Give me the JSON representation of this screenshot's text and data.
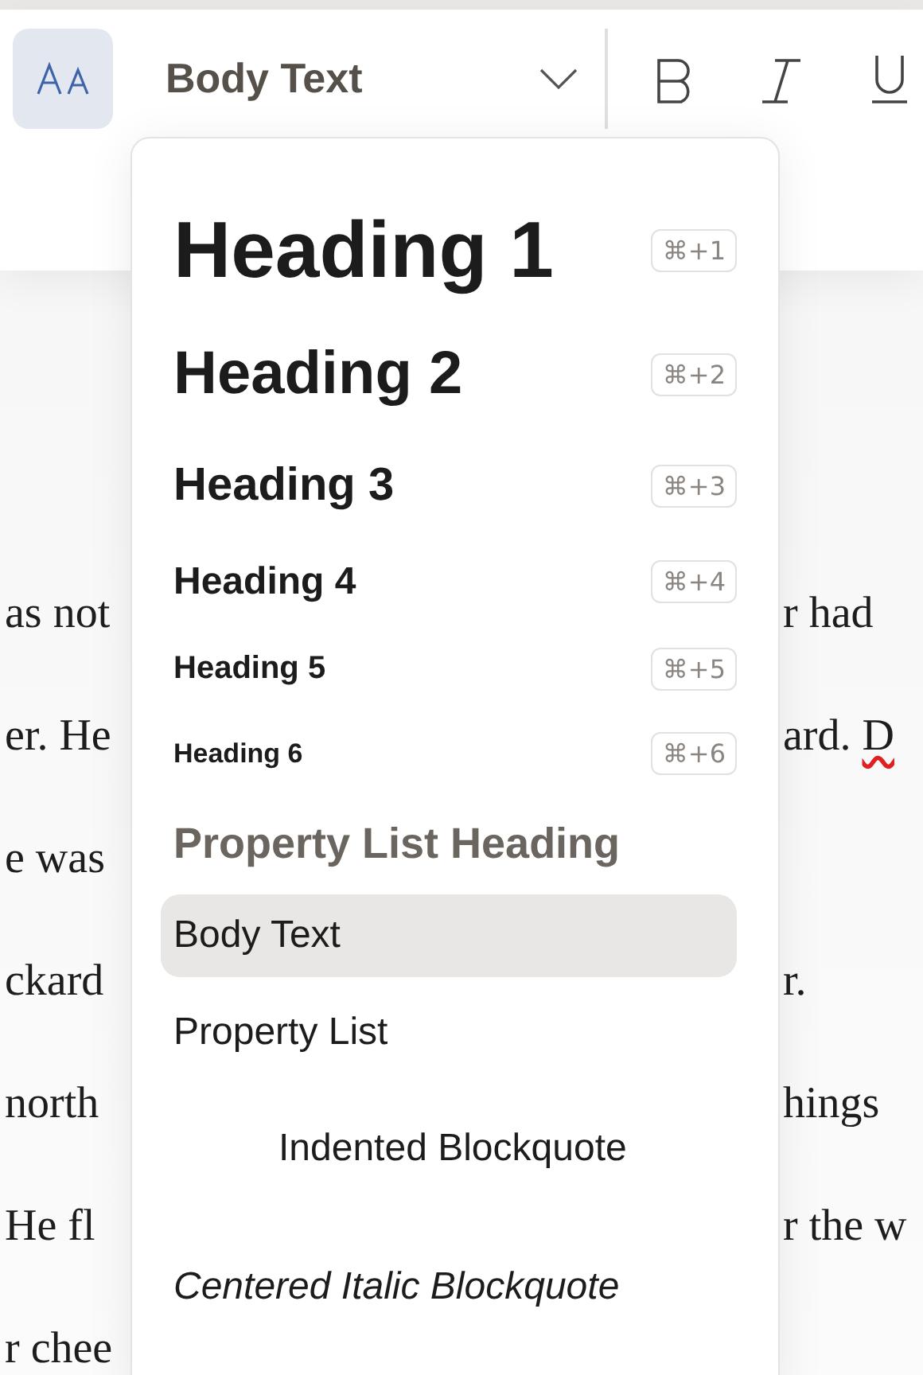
{
  "toolbar": {
    "style_dropdown": {
      "value": "Body Text"
    }
  },
  "style_menu": [
    {
      "label": "Heading 1",
      "kind": "h1",
      "shortcut": "⌘+1",
      "selected": false
    },
    {
      "label": "Heading 2",
      "kind": "h2",
      "shortcut": "⌘+2",
      "selected": false
    },
    {
      "label": "Heading 3",
      "kind": "h3",
      "shortcut": "⌘+3",
      "selected": false
    },
    {
      "label": "Heading 4",
      "kind": "h4",
      "shortcut": "⌘+4",
      "selected": false
    },
    {
      "label": "Heading 5",
      "kind": "h5",
      "shortcut": "⌘+5",
      "selected": false
    },
    {
      "label": "Heading 6",
      "kind": "h6",
      "shortcut": "⌘+6",
      "selected": false
    },
    {
      "label": "Property List Heading",
      "kind": "property-heading",
      "selected": false
    },
    {
      "label": "Body Text",
      "kind": "body",
      "selected": true
    },
    {
      "label": "Property List",
      "kind": "property-list",
      "selected": false
    },
    {
      "label": "Indented Blockquote",
      "kind": "indented-quote",
      "selected": false
    },
    {
      "label": "Centered Italic Blockquote",
      "kind": "italic-quote",
      "selected": false
    }
  ],
  "document_lines": [
    {
      "left": "as not",
      "right": [
        {
          "text": "r had",
          "misspelled": false
        }
      ]
    },
    {
      "left": "er. He",
      "right": [
        {
          "text": "ard.",
          "misspelled": false
        },
        {
          "text": "D",
          "misspelled": true
        }
      ]
    },
    {
      "left": "e was"
    },
    {
      "left": "ckard",
      "right": [
        {
          "text": "r.",
          "misspelled": false
        }
      ]
    },
    {
      "left": "north",
      "right": [
        {
          "text": "hings",
          "misspelled": false
        }
      ]
    },
    {
      "left": "He fl",
      "right": [
        {
          "text": "r the w",
          "misspelled": false
        }
      ]
    },
    {
      "left": "r chee"
    }
  ]
}
